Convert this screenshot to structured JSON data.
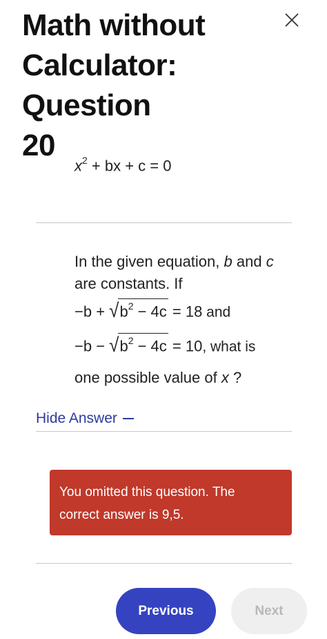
{
  "header": {
    "title_line1": "Math without",
    "title_line2": "Calculator: Question",
    "title_line3": "20",
    "close_icon": "close-icon"
  },
  "equation": {
    "x": "x",
    "exp": "2",
    "rest": " + bx + c = 0"
  },
  "question": {
    "line1_text": "In the given equation, ",
    "b": "b",
    "and": " and ",
    "c": "c",
    "line2_text": "are constants. If",
    "eq1_left": "−b + ",
    "eq1_sqrt_b": "b",
    "eq1_sqrt_exp": "2",
    "eq1_sqrt_rest": " − 4c",
    "eq1_right": " = 18",
    "eq1_and": " and",
    "eq2_left": "−b − ",
    "eq2_sqrt_b": "b",
    "eq2_sqrt_exp": "2",
    "eq2_sqrt_rest": " − 4c",
    "eq2_right": " = 10",
    "eq2_tail": ", what is",
    "line5_text": "one possible value of ",
    "line5_x": "x",
    "line5_q": " ?"
  },
  "answer_toggle": {
    "label": "Hide Answer"
  },
  "answer": {
    "line1": "You omitted this question. The",
    "line2": "correct answer is 9,5."
  },
  "navigation": {
    "previous_label": "Previous",
    "next_label": "Next"
  },
  "colors": {
    "accent": "#3543c0",
    "link": "#2c3a9e",
    "error": "#c0392b",
    "disabled_bg": "#efefef"
  }
}
